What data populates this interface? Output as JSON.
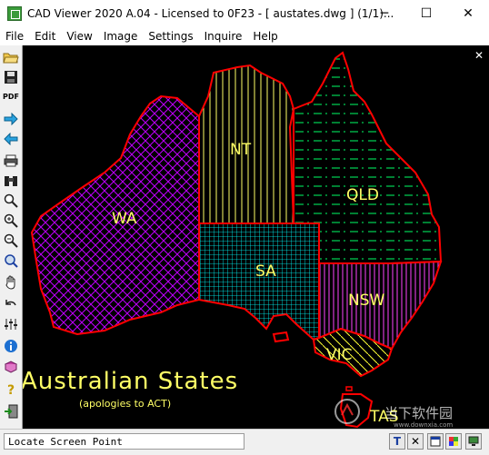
{
  "window": {
    "title": "CAD Viewer 2020 A.04 - Licensed to 0F23  -  [ austates.dwg ] (1/1)...",
    "minimize_glyph": "─",
    "maximize_glyph": "☐",
    "close_glyph": "✕"
  },
  "menu": [
    "File",
    "Edit",
    "View",
    "Image",
    "Settings",
    "Inquire",
    "Help"
  ],
  "toolbar": {
    "icons": [
      "open-folder-icon",
      "save-disk-icon",
      "pdf-icon",
      "arrow-right-icon",
      "arrow-left-icon",
      "print-icon",
      "binoculars-icon",
      "zoom-window-icon",
      "zoom-in-icon",
      "zoom-out-icon",
      "zoom-extents-icon",
      "pan-hand-icon",
      "undo-icon",
      "layers-icon",
      "info-icon",
      "book-icon",
      "help-icon",
      "exit-door-icon"
    ],
    "pdf_label": "PDF"
  },
  "drawing": {
    "close_glyph": "✕",
    "title": "Australian States",
    "subtitle": "(apologies to ACT)",
    "states": {
      "wa": "WA",
      "nt": "NT",
      "qld": "QLD",
      "sa": "SA",
      "nsw": "NSW",
      "vic": "VIC",
      "tas": "TAS"
    },
    "colors": {
      "outline": "#ff0000",
      "wa": "#c000ff",
      "nt": "#ffff66",
      "qld": "#00ff66",
      "sa": "#00ffff",
      "nsw": "#ff44ff",
      "vic": "#ffff33",
      "label": "#ffff66"
    }
  },
  "status": {
    "text": "Locate Screen Point",
    "buttons": [
      "T",
      "✕",
      "",
      "",
      ""
    ]
  },
  "watermark": {
    "text_cn": "当下软件园",
    "url": "www.downxia.com"
  }
}
